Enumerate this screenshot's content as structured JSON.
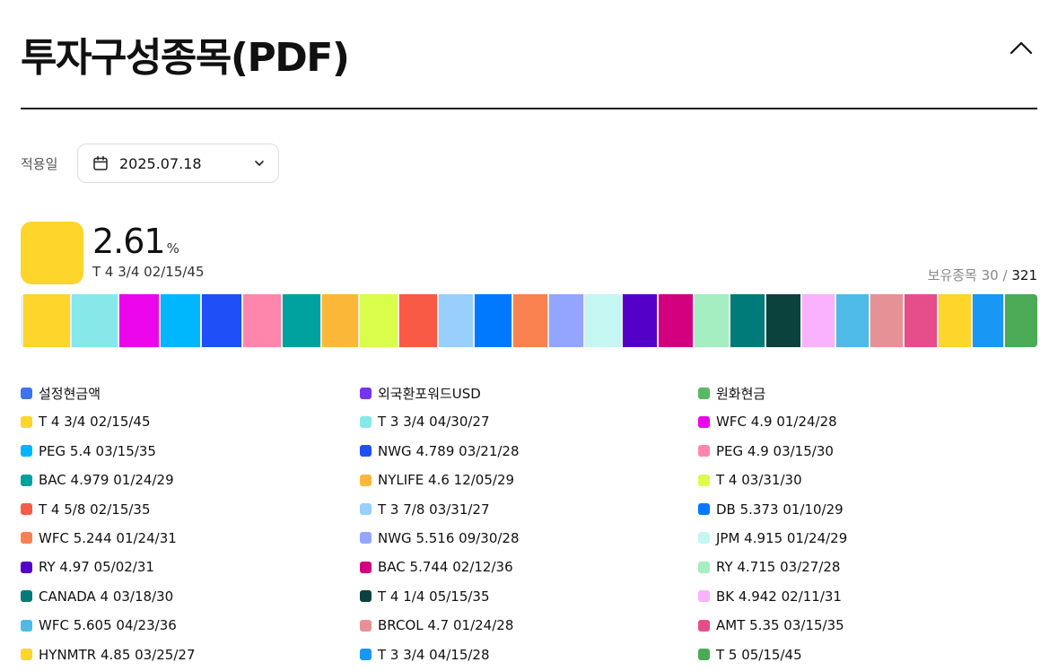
{
  "header": {
    "title": "투자구성종목(PDF)"
  },
  "date_filter": {
    "label": "적용일",
    "value": "2025.07.18"
  },
  "summary": {
    "percent": "2.61",
    "unit": "%",
    "holding": "T 4 3/4 02/15/45",
    "color": "#fdd52b"
  },
  "holding_count": {
    "label": "보유종목",
    "shown": "30",
    "separator": "/",
    "total": "321"
  },
  "bar_segments": [
    {
      "color": "#fdd52b",
      "weight": 2.61
    },
    {
      "color": "#86e8e8",
      "weight": 2.55
    },
    {
      "color": "#ec06ec",
      "weight": 2.2
    },
    {
      "color": "#00b6ff",
      "weight": 2.2
    },
    {
      "color": "#1f4ff6",
      "weight": 2.2
    },
    {
      "color": "#fe86ac",
      "weight": 2.1
    },
    {
      "color": "#00a29f",
      "weight": 2.1
    },
    {
      "color": "#fbb838",
      "weight": 2.0
    },
    {
      "color": "#dafc4a",
      "weight": 2.1
    },
    {
      "color": "#f85a45",
      "weight": 2.1
    },
    {
      "color": "#98cffd",
      "weight": 1.9
    },
    {
      "color": "#0079ff",
      "weight": 2.05
    },
    {
      "color": "#f9804f",
      "weight": 1.9
    },
    {
      "color": "#93a5fe",
      "weight": 1.9
    },
    {
      "color": "#c4f7f2",
      "weight": 2.0
    },
    {
      "color": "#5400c9",
      "weight": 1.9
    },
    {
      "color": "#d2007e",
      "weight": 1.9
    },
    {
      "color": "#a5eec2",
      "weight": 1.9
    },
    {
      "color": "#007b79",
      "weight": 1.9
    },
    {
      "color": "#0b423e",
      "weight": 1.9
    },
    {
      "color": "#fab2fe",
      "weight": 1.8
    },
    {
      "color": "#4ebbe6",
      "weight": 1.8
    },
    {
      "color": "#e69195",
      "weight": 1.8
    },
    {
      "color": "#e64e8b",
      "weight": 1.8
    },
    {
      "color": "#fdd52b",
      "weight": 1.8
    },
    {
      "color": "#1897f4",
      "weight": 1.7
    },
    {
      "color": "#4aaa56",
      "weight": 1.7
    }
  ],
  "legend": [
    {
      "label": "설정현금액",
      "color": "#3d75ee"
    },
    {
      "label": "외국환포워드USD",
      "color": "#7335f0"
    },
    {
      "label": "원화현금",
      "color": "#5ab866"
    },
    {
      "label": "T 4 3/4 02/15/45",
      "color": "#fdd52b"
    },
    {
      "label": "T 3 3/4 04/30/27",
      "color": "#86e8e8"
    },
    {
      "label": "WFC 4.9 01/24/28",
      "color": "#ec06ec"
    },
    {
      "label": "PEG 5.4 03/15/35",
      "color": "#00b6ff"
    },
    {
      "label": "NWG 4.789 03/21/28",
      "color": "#1f4ff6"
    },
    {
      "label": "PEG 4.9 03/15/30",
      "color": "#fe86ac"
    },
    {
      "label": "BAC 4.979 01/24/29",
      "color": "#00a29f"
    },
    {
      "label": "NYLIFE 4.6 12/05/29",
      "color": "#fbb838"
    },
    {
      "label": "T 4 03/31/30",
      "color": "#dafc4a"
    },
    {
      "label": "T 4 5/8 02/15/35",
      "color": "#f85a45"
    },
    {
      "label": "T 3 7/8 03/31/27",
      "color": "#98cffd"
    },
    {
      "label": "DB 5.373 01/10/29",
      "color": "#0079ff"
    },
    {
      "label": "WFC 5.244 01/24/31",
      "color": "#f9804f"
    },
    {
      "label": "NWG 5.516 09/30/28",
      "color": "#93a5fe"
    },
    {
      "label": "JPM 4.915 01/24/29",
      "color": "#c4f7f2"
    },
    {
      "label": "RY 4.97 05/02/31",
      "color": "#5400c9"
    },
    {
      "label": "BAC 5.744 02/12/36",
      "color": "#d2007e"
    },
    {
      "label": "RY 4.715 03/27/28",
      "color": "#a5eec2"
    },
    {
      "label": "CANADA 4 03/18/30",
      "color": "#007b79"
    },
    {
      "label": "T 4 1/4 05/15/35",
      "color": "#0b423e"
    },
    {
      "label": "BK 4.942 02/11/31",
      "color": "#fab2fe"
    },
    {
      "label": "WFC 5.605 04/23/36",
      "color": "#4ebbe6"
    },
    {
      "label": "BRCOL 4.7 01/24/28",
      "color": "#e69195"
    },
    {
      "label": "AMT 5.35 03/15/35",
      "color": "#e64e8b"
    },
    {
      "label": "HYNMTR 4.85 03/25/27",
      "color": "#fdd52b"
    },
    {
      "label": "T 3 3/4 04/15/28",
      "color": "#1897f4"
    },
    {
      "label": "T 5 05/15/45",
      "color": "#4aaa56"
    }
  ],
  "icons": {
    "collapse": "chevron-up-icon",
    "calendar": "calendar-icon",
    "dropdown": "chevron-down-icon"
  }
}
